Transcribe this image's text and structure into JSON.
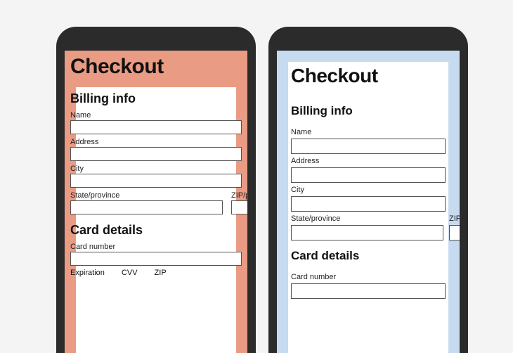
{
  "left": {
    "tint": "#e68a6e",
    "title": "Checkout",
    "billing": {
      "heading": "Billing info",
      "name_label": "Name",
      "address_label": "Address",
      "city_label": "City",
      "state_label": "State/province",
      "zip_label": "ZIP/postal code"
    },
    "card": {
      "heading": "Card details",
      "number_label": "Card number",
      "expiration_label": "Expiration",
      "cvv_label": "CVV",
      "zip_label": "ZIP"
    }
  },
  "right": {
    "tint": "#c4d9ef",
    "title": "Checkout",
    "billing": {
      "heading": "Billing info",
      "name_label": "Name",
      "address_label": "Address",
      "city_label": "City",
      "state_label": "State/province",
      "zip_label": "ZIP/postal code"
    },
    "card": {
      "heading": "Card details",
      "number_label": "Card number"
    }
  }
}
